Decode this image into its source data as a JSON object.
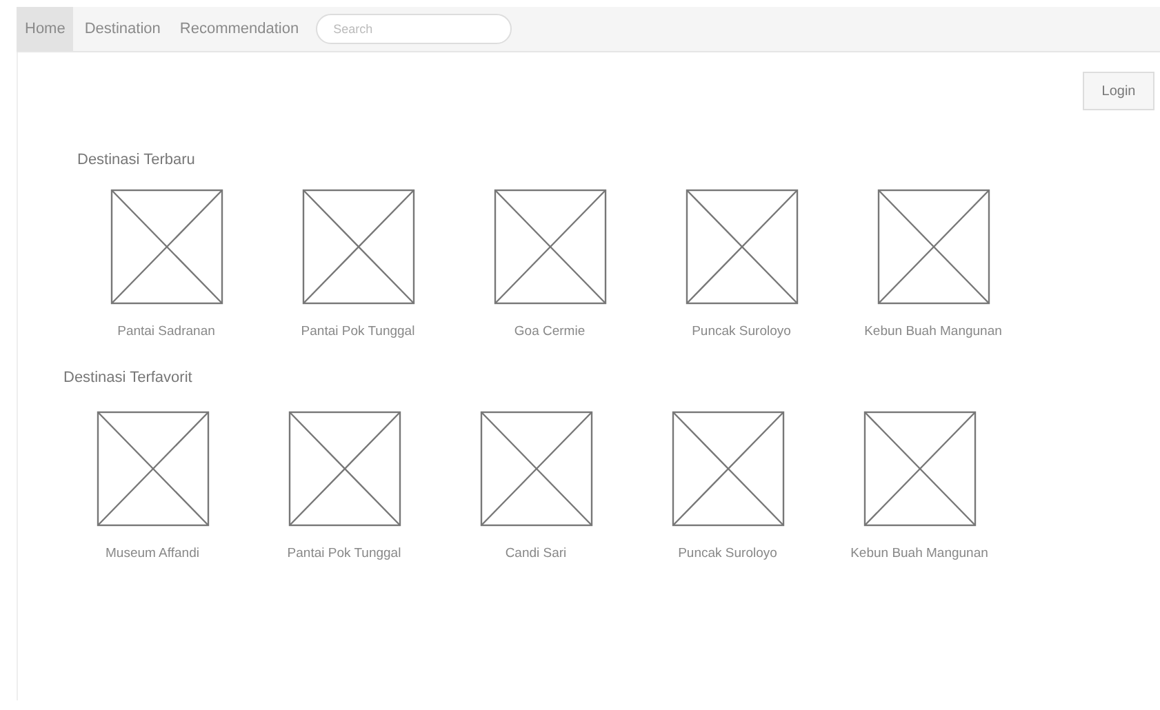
{
  "nav": {
    "tabs": [
      {
        "label": "Home",
        "selected": true
      },
      {
        "label": "Destination",
        "selected": false
      },
      {
        "label": "Recommendation",
        "selected": false
      }
    ],
    "search": {
      "placeholder": "Search"
    }
  },
  "login_button": "Login",
  "sections": [
    {
      "title": "Destinasi Terbaru",
      "items": [
        {
          "caption": "Pantai Sadranan"
        },
        {
          "caption": "Pantai Pok Tunggal"
        },
        {
          "caption": "Goa Cermie"
        },
        {
          "caption": "Puncak Suroloyo"
        },
        {
          "caption": "Kebun Buah Mangunan"
        }
      ]
    },
    {
      "title": "Destinasi Terfavorit",
      "items": [
        {
          "caption": "Museum Affandi"
        },
        {
          "caption": "Pantai Pok Tunggal"
        },
        {
          "caption": "Candi Sari"
        },
        {
          "caption": "Puncak Suroloyo"
        },
        {
          "caption": "Kebun Buah Mangunan"
        }
      ]
    }
  ]
}
